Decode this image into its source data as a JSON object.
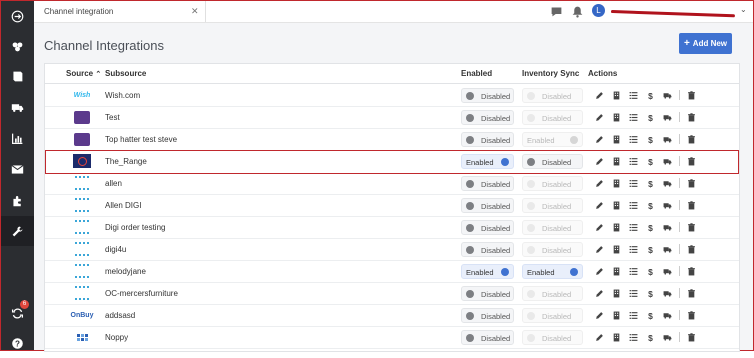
{
  "header": {
    "tab_label": "Channel integration",
    "tab_close": "✕",
    "avatar_initial": "L",
    "user_name": "redacted",
    "user_chevron": "⌄"
  },
  "sidebar": {
    "badge_count": "6",
    "items": [
      "home-icon",
      "sales-icon",
      "book-icon",
      "shipping-icon",
      "reports-icon",
      "mail-icon",
      "integrations-icon",
      "settings-icon",
      "sync-icon",
      "help-icon"
    ]
  },
  "page": {
    "title": "Channel Integrations",
    "add_button": "Add New",
    "add_plus": "+"
  },
  "table": {
    "headers": {
      "source": "Source",
      "sort_arrow": "⌃",
      "subsource": "Subsource",
      "enabled": "Enabled",
      "inventory_sync": "Inventory Sync",
      "actions": "Actions"
    },
    "rows": [
      {
        "logo": "wish",
        "logo_text": "Wish",
        "subsource": "Wish.com",
        "enabled": "Disabled",
        "enabled_on": false,
        "inv": "Disabled",
        "inv_on": false,
        "inv_disabled": true
      },
      {
        "logo": "purple",
        "logo_text": "",
        "subsource": "Test",
        "enabled": "Disabled",
        "enabled_on": false,
        "inv": "Disabled",
        "inv_on": false,
        "inv_disabled": true
      },
      {
        "logo": "purple",
        "logo_text": "",
        "subsource": "Top hatter test steve",
        "enabled": "Disabled",
        "enabled_on": false,
        "inv": "Enabled",
        "inv_on": true,
        "inv_disabled": true
      },
      {
        "logo": "range",
        "logo_text": "Range",
        "subsource": "The_Range",
        "enabled": "Enabled",
        "enabled_on": true,
        "inv": "Disabled",
        "inv_on": false,
        "inv_disabled": false
      },
      {
        "logo": "api",
        "logo_text": "",
        "subsource": "allen",
        "enabled": "Disabled",
        "enabled_on": false,
        "inv": "Disabled",
        "inv_on": false,
        "inv_disabled": true
      },
      {
        "logo": "api",
        "logo_text": "",
        "subsource": "Allen DIGI",
        "enabled": "Disabled",
        "enabled_on": false,
        "inv": "Disabled",
        "inv_on": false,
        "inv_disabled": true
      },
      {
        "logo": "api",
        "logo_text": "",
        "subsource": "Digi order testing",
        "enabled": "Disabled",
        "enabled_on": false,
        "inv": "Disabled",
        "inv_on": false,
        "inv_disabled": true
      },
      {
        "logo": "api",
        "logo_text": "",
        "subsource": "digi4u",
        "enabled": "Disabled",
        "enabled_on": false,
        "inv": "Disabled",
        "inv_on": false,
        "inv_disabled": true
      },
      {
        "logo": "api",
        "logo_text": "",
        "subsource": "melodyjane",
        "enabled": "Enabled",
        "enabled_on": true,
        "inv": "Enabled",
        "inv_on": true,
        "inv_disabled": false
      },
      {
        "logo": "api",
        "logo_text": "",
        "subsource": "OC-mercersfurniture",
        "enabled": "Disabled",
        "enabled_on": false,
        "inv": "Disabled",
        "inv_on": false,
        "inv_disabled": true
      },
      {
        "logo": "onbuy",
        "logo_text": "OnBuy",
        "subsource": "addsasd",
        "enabled": "Disabled",
        "enabled_on": false,
        "inv": "Disabled",
        "inv_on": false,
        "inv_disabled": true
      },
      {
        "logo": "noppy",
        "logo_text": "",
        "subsource": "Noppy",
        "enabled": "Disabled",
        "enabled_on": false,
        "inv": "Disabled",
        "inv_on": false,
        "inv_disabled": true
      }
    ],
    "action_icons": [
      "edit-icon",
      "building-icon",
      "list-icon",
      "dollar-icon",
      "truck-icon",
      "trash-icon"
    ],
    "highlighted_row": "The_Range"
  },
  "colors": {
    "sidebar": "#2b2d31",
    "accent": "#3f72d1",
    "highlight": "#c0282d",
    "page_bg": "#f4f5f7"
  }
}
